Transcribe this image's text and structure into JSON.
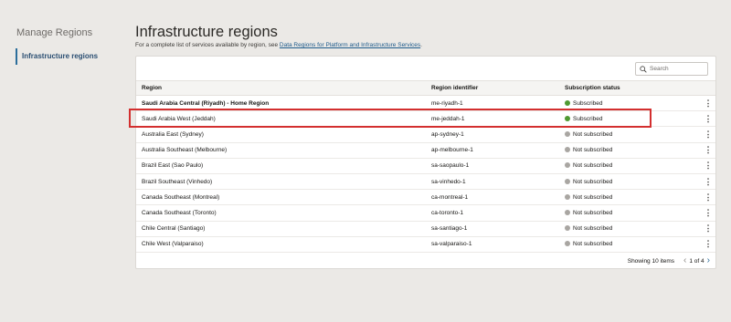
{
  "sidebar": {
    "title": "Manage Regions",
    "items": [
      {
        "label": "Infrastructure regions"
      }
    ]
  },
  "main": {
    "title": "Infrastructure regions",
    "description_prefix": "For a complete list of services available by region, see ",
    "description_link": "Data Regions for Platform and Infrastructure Services",
    "description_suffix": "."
  },
  "search": {
    "placeholder": "Search"
  },
  "table": {
    "headers": [
      "Region",
      "Region identifier",
      "Subscription status"
    ],
    "rows": [
      {
        "region": "Saudi Arabia Central (Riyadh) - Home Region",
        "id": "me-riyadh-1",
        "status": "Subscribed",
        "status_color": "#4f9a32",
        "bold": true
      },
      {
        "region": "Saudi Arabia West (Jeddah)",
        "id": "me-jeddah-1",
        "status": "Subscribed",
        "status_color": "#4f9a32",
        "bold": false
      },
      {
        "region": "Australia East (Sydney)",
        "id": "ap-sydney-1",
        "status": "Not subscribed",
        "status_color": "#a9a6a2",
        "bold": false
      },
      {
        "region": "Australia Southeast (Melbourne)",
        "id": "ap-melbourne-1",
        "status": "Not subscribed",
        "status_color": "#a9a6a2",
        "bold": false
      },
      {
        "region": "Brazil East (Sao Paulo)",
        "id": "sa-saopaulo-1",
        "status": "Not subscribed",
        "status_color": "#a9a6a2",
        "bold": false
      },
      {
        "region": "Brazil Southeast (Vinhedo)",
        "id": "sa-vinhedo-1",
        "status": "Not subscribed",
        "status_color": "#a9a6a2",
        "bold": false
      },
      {
        "region": "Canada Southeast (Montreal)",
        "id": "ca-montreal-1",
        "status": "Not subscribed",
        "status_color": "#a9a6a2",
        "bold": false
      },
      {
        "region": "Canada Southeast (Toronto)",
        "id": "ca-toronto-1",
        "status": "Not subscribed",
        "status_color": "#a9a6a2",
        "bold": false
      },
      {
        "region": "Chile Central (Santiago)",
        "id": "sa-santiago-1",
        "status": "Not subscribed",
        "status_color": "#a9a6a2",
        "bold": false
      },
      {
        "region": "Chile West (Valparaiso)",
        "id": "sa-valparaiso-1",
        "status": "Not subscribed",
        "status_color": "#a9a6a2",
        "bold": false
      }
    ]
  },
  "footer": {
    "showing": "Showing 10 items",
    "page_info": "1 of 4"
  },
  "colors": {
    "accent": "#2b6e9b",
    "highlight": "#d32f2f",
    "subscribed": "#4f9a32",
    "not_subscribed": "#a9a6a2"
  }
}
